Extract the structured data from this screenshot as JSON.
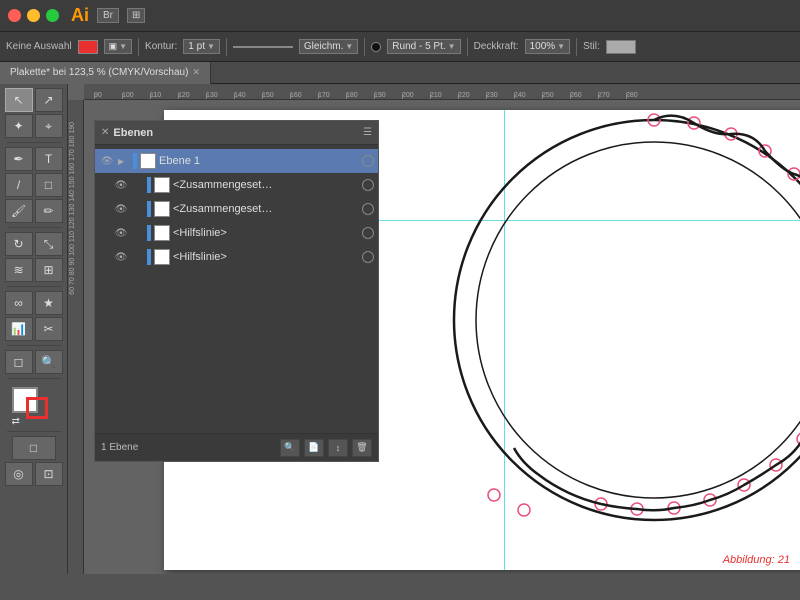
{
  "titlebar": {
    "ai_label": "Ai",
    "br_label": "Br",
    "layout_label": "⊞"
  },
  "toolbar": {
    "keine_auswahl": "Keine Auswahl",
    "kontur_label": "Kontur:",
    "kontur_value": "1 pt",
    "gleichm_label": "Gleichm.",
    "rund_label": "Rund - 5 Pt.",
    "deckkraft_label": "Deckkraft:",
    "deckkraft_value": "100%",
    "stil_label": "Stil:"
  },
  "doc_tab": {
    "title": "Plakette* bei 123,5 % (CMYK/Vorschau)"
  },
  "layers_panel": {
    "title": "Ebenen",
    "layers": [
      {
        "name": "Ebene 1",
        "level": 0,
        "selected": true,
        "has_triangle": true,
        "has_thumb": true
      },
      {
        "name": "<Zusammengeset…",
        "level": 1,
        "selected": false,
        "has_triangle": false,
        "has_thumb": true
      },
      {
        "name": "<Zusammengeset…",
        "level": 1,
        "selected": false,
        "has_triangle": false,
        "has_thumb": true
      },
      {
        "name": "<Hilfslinie>",
        "level": 1,
        "selected": false,
        "has_triangle": false,
        "has_thumb": true
      },
      {
        "name": "<Hilfslinie>",
        "level": 1,
        "selected": false,
        "has_triangle": false,
        "has_thumb": true
      }
    ],
    "footer_label": "1 Ebene",
    "footer_buttons": [
      "🔍",
      "📄",
      "↓",
      "🗑"
    ]
  },
  "ruler": {
    "top_marks": [
      "90",
      "100",
      "110",
      "120",
      "130",
      "140",
      "150",
      "160",
      "170",
      "180",
      "190",
      "200",
      "210",
      "220",
      "230",
      "240",
      "250",
      "260",
      "270",
      "280"
    ],
    "left_marks": [
      "60",
      "70",
      "80",
      "90",
      "100",
      "110",
      "120",
      "130",
      "140",
      "150",
      "160",
      "170",
      "180",
      "190"
    ]
  },
  "status": {
    "abbildung": "Abbildung: 21"
  },
  "bottom": {
    "layer_label": "Ebene 1"
  }
}
